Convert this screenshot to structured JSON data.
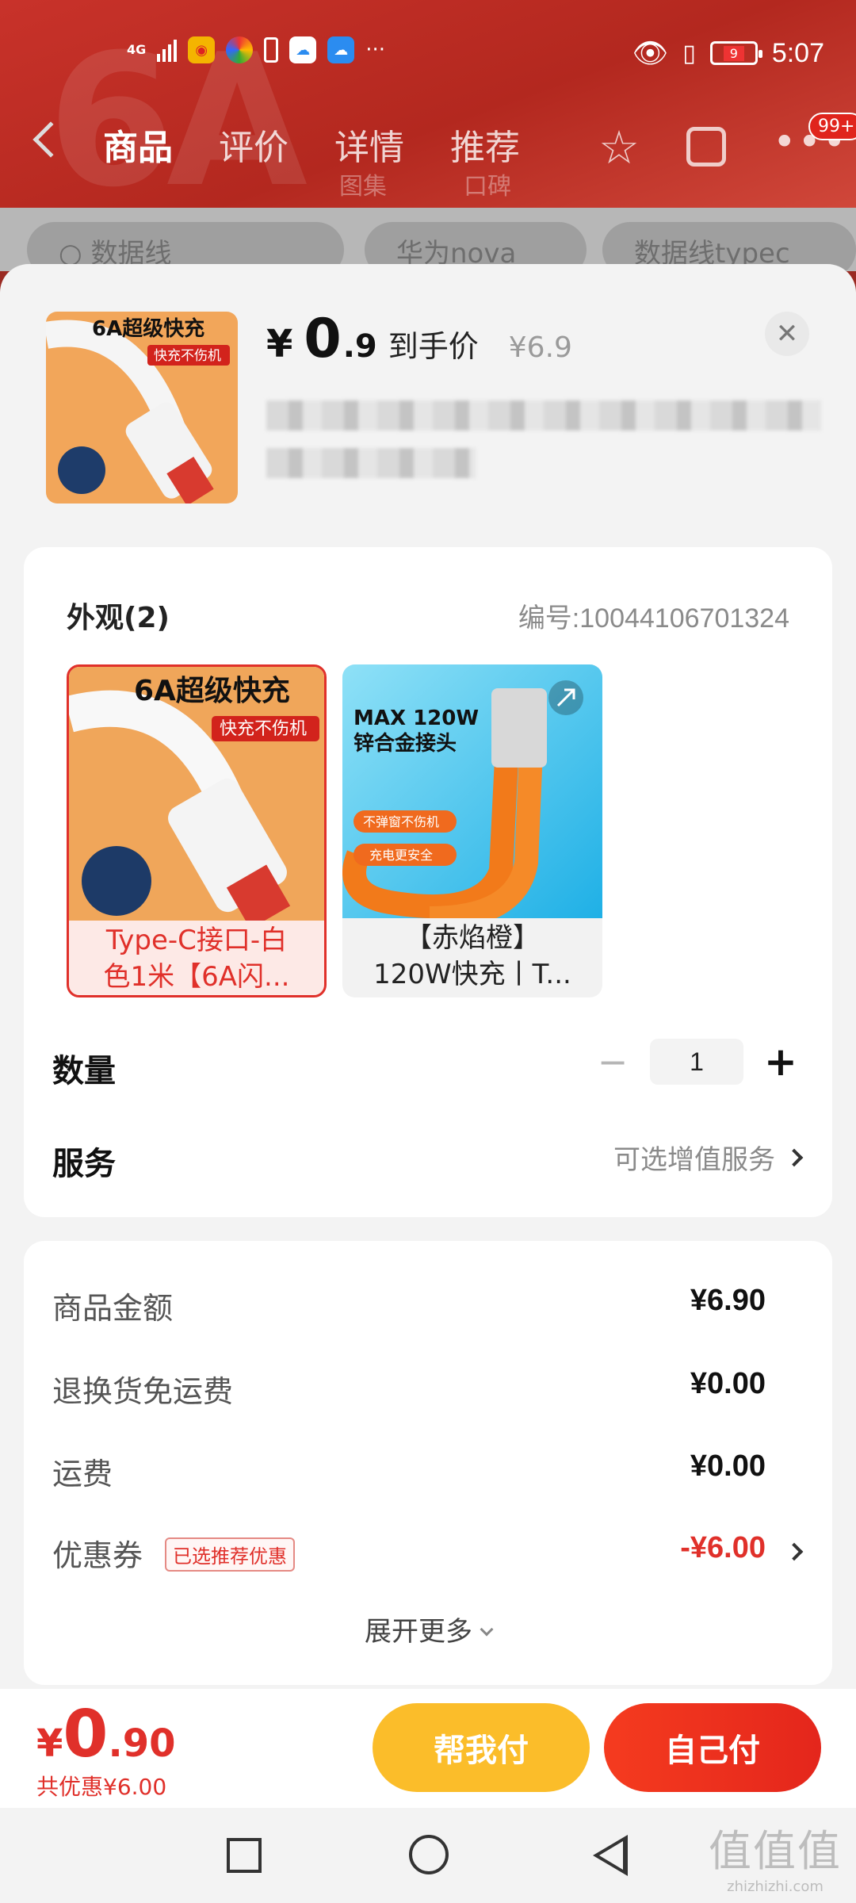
{
  "status_bar": {
    "time": "5:07",
    "network": "4G",
    "battery": "9",
    "more": "···"
  },
  "nav": {
    "tabs": [
      "商品",
      "评价",
      "详情",
      "推荐"
    ],
    "sub_tabs": [
      "图集",
      "口碑"
    ],
    "badge": "99+",
    "icons": [
      "back-icon",
      "star-icon",
      "share-icon",
      "more-icon"
    ]
  },
  "search_pills": [
    "数据线",
    "华为nova",
    "数据线typec"
  ],
  "product": {
    "price_symbol": "¥",
    "price_int": "0",
    "price_dec": ".9",
    "price_label": "到手价",
    "original_price": "¥6.9",
    "thumb_title": "6A超级快充",
    "thumb_tag": "快充不伤机"
  },
  "appearance": {
    "title": "外观(2)",
    "code": "编号:10044106701324",
    "options": [
      {
        "img_title": "6A超级快充",
        "img_tag": "快充不伤机",
        "line1": "Type-C接口-白",
        "line2": "色1米【6A闪...",
        "selected": true
      },
      {
        "img_title1": "MAX 120W",
        "img_title2": "锌合金接头",
        "img_tag1": "不弹窗不伤机",
        "img_tag2": "充电更安全",
        "line1": "【赤焰橙】",
        "line2": "120W快充丨T...",
        "selected": false
      }
    ]
  },
  "quantity": {
    "label": "数量",
    "value": "1",
    "minus": "−",
    "plus": "+"
  },
  "service": {
    "label": "服务",
    "value": "可选增值服务"
  },
  "summary": {
    "items": [
      {
        "label": "商品金额",
        "amount": "¥6.90"
      },
      {
        "label": "退换货免运费",
        "amount": "¥0.00"
      },
      {
        "label": "运费",
        "amount": "¥0.00"
      },
      {
        "label": "优惠券",
        "tag": "已选推荐优惠",
        "amount": "-¥6.00"
      }
    ],
    "expand": "展开更多"
  },
  "bottom": {
    "price_symbol": "¥",
    "price_int": "0",
    "price_dec": ".90",
    "savings": "共优惠¥6.00",
    "help_pay": "帮我付",
    "self_pay": "自己付"
  },
  "watermark": {
    "glyphs": "值值值",
    "url": "zhizhizhi.com"
  },
  "colors": {
    "accent_red": "#e0302a",
    "help_yellow": "#fbbd2a"
  }
}
